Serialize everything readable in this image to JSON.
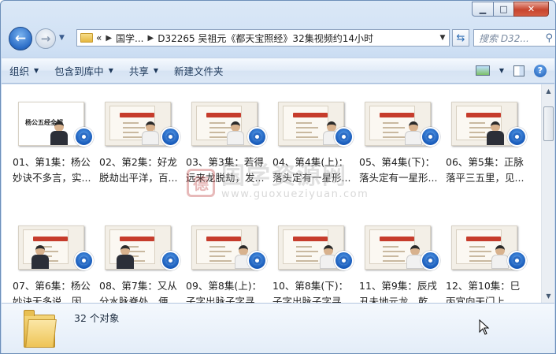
{
  "window": {
    "caption": {
      "minimize": "▁",
      "maximize": "□",
      "close": "✕"
    }
  },
  "nav": {
    "back": "←",
    "forward": "→",
    "breadcrumb": [
      "«",
      "国学...",
      "D32265 吴祖元《都天宝照经》32集视频约14小时"
    ],
    "refresh": "⇆",
    "search_placeholder": "搜索 D32...",
    "search_icon": "search-icon"
  },
  "commands": {
    "organize": "组织",
    "include_library": "包含到库中",
    "share": "共享",
    "new_folder": "新建文件夹"
  },
  "files": [
    {
      "line1": "01、第1集：杨公",
      "line2": "妙诀不多言，实...",
      "cover_title": "杨公五经全解"
    },
    {
      "line1": "02、第2集：好龙",
      "line2": "脱劫出平洋，百..."
    },
    {
      "line1": "03、第3集：若得",
      "line2": "远来龙脱劫，发..."
    },
    {
      "line1": "04、第4集(上)：",
      "line2": "落头定有一星形..."
    },
    {
      "line1": "05、第4集(下)：",
      "line2": "落头定有一星形..."
    },
    {
      "line1": "06、第5集：正脉",
      "line2": "落平三五里，见..."
    },
    {
      "line1": "07、第6集：杨公",
      "line2": "妙诀无多说，因..."
    },
    {
      "line1": "08、第7集：又从",
      "line2": "分水脉脊处，便..."
    },
    {
      "line1": "09、第8集(上)：",
      "line2": "子字出脉子字寻..."
    },
    {
      "line1": "10、第8集(下)：",
      "line2": "子字出脉子字寻..."
    },
    {
      "line1": "11、第9集：辰戌",
      "line2": "丑未地元龙，乾..."
    },
    {
      "line1": "12、第10集：巳",
      "line2": "丙宜向天门上，..."
    }
  ],
  "watermark": {
    "logo": "德",
    "name": "国学资源网",
    "url": "www.guoxueziyuan.com"
  },
  "status": {
    "object_count": "32 个对象"
  },
  "colors": {
    "badge": "#1f63c0",
    "banner": "#c63c2c"
  }
}
